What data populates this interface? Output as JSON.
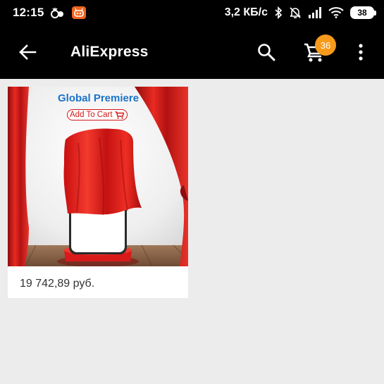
{
  "status_bar": {
    "time": "12:15",
    "net_speed": "3,2 КБ/с",
    "battery": "38",
    "icons": [
      "alarm-icon",
      "app-notification-icon",
      "bluetooth-icon",
      "silent-mode-icon",
      "signal-icon",
      "wifi-icon",
      "battery-icon"
    ]
  },
  "toolbar": {
    "title": "AliExpress",
    "cart_count": "36",
    "icons": [
      "back-arrow-icon",
      "search-icon",
      "cart-icon",
      "more-vert-icon"
    ]
  },
  "product": {
    "image_title": "Global Premiere",
    "image_button": "Add To Cart",
    "price": "19 742,89 руб."
  },
  "colors": {
    "toolbar_bg": "#000000",
    "page_bg": "#ececec",
    "badge": "#f59a1b",
    "promo_blue": "#1a73c9",
    "curtain_red": "#e21a1a"
  }
}
